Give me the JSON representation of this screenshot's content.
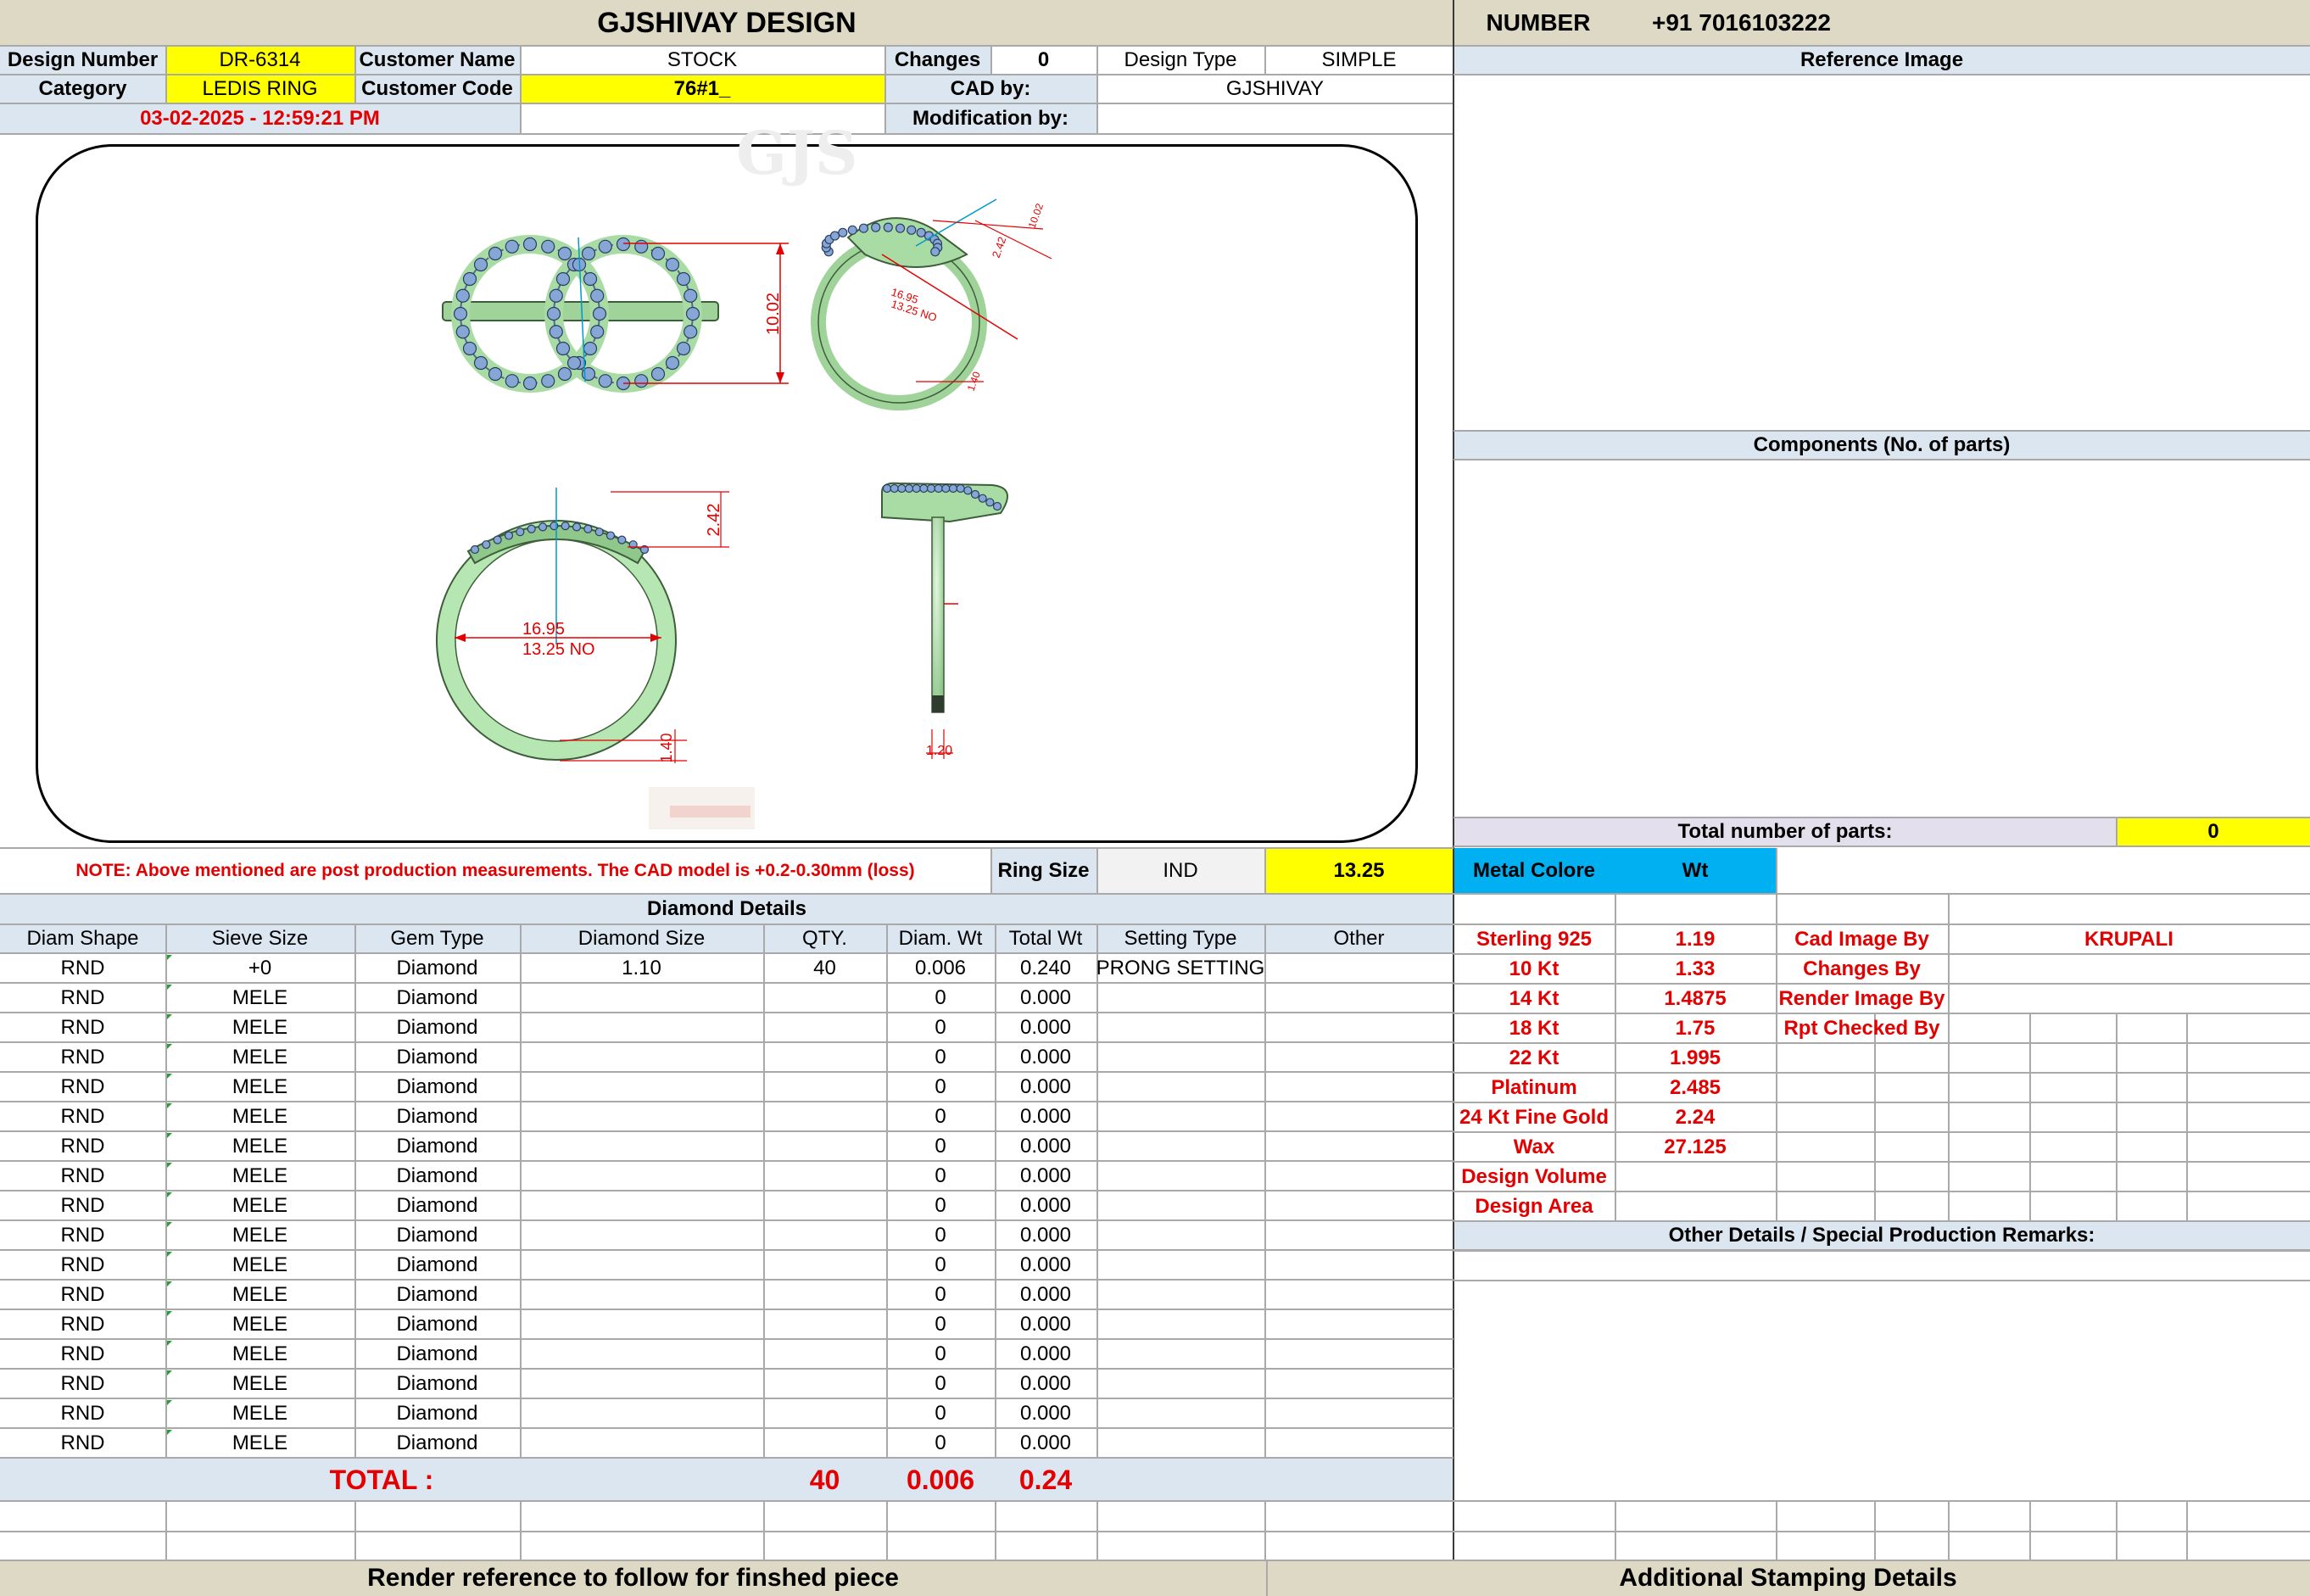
{
  "header": {
    "title": "GJSHIVAY DESIGN",
    "number_label": "NUMBER",
    "number_value": "+91 7016103222"
  },
  "info": {
    "design_number_label": "Design Number",
    "design_number": "DR-6314",
    "customer_name_label": "Customer Name",
    "customer_name": "STOCK",
    "changes_label": "Changes",
    "changes": "0",
    "design_type_label": "Design Type",
    "design_type": "SIMPLE",
    "category_label": "Category",
    "category": "LEDIS RING",
    "customer_code_label": "Customer Code",
    "customer_code": "76#1_",
    "cad_by_label": "CAD by:",
    "cad_by": "GJSHIVAY",
    "datetime": "03-02-2025 - 12:59:21 PM",
    "modification_label": "Modification by:"
  },
  "drawing": {
    "dim_height": "10.02",
    "dim_top": "2.42",
    "dim_diameter": "16.95",
    "dim_ring_no": "13.25 NO",
    "dim_bottom": "1.40",
    "dim_shank": "1.20",
    "dim_iso_a": "16.95",
    "dim_iso_b": "13.25 NO",
    "dim_iso_c": "2.42",
    "dim_iso_d": "10.02",
    "dim_iso_e": "1.40"
  },
  "note": "NOTE: Above mentioned are post production measurements. The CAD model is +0.2-0.30mm (loss)",
  "ring_size": {
    "label": "Ring Size",
    "system": "IND",
    "value": "13.25"
  },
  "diamond": {
    "title": "Diamond Details",
    "headers": [
      "Diam Shape",
      "Sieve Size",
      "Gem Type",
      "Diamond Size",
      "QTY.",
      "Diam. Wt",
      "Total Wt",
      "Setting Type",
      "Other"
    ],
    "rows": [
      [
        "RND",
        "+0",
        "Diamond",
        "1.10",
        "40",
        "0.006",
        "0.240",
        "PRONG SETTING",
        ""
      ],
      [
        "RND",
        "MELE",
        "Diamond",
        "",
        "",
        "0",
        "0.000",
        "",
        ""
      ],
      [
        "RND",
        "MELE",
        "Diamond",
        "",
        "",
        "0",
        "0.000",
        "",
        ""
      ],
      [
        "RND",
        "MELE",
        "Diamond",
        "",
        "",
        "0",
        "0.000",
        "",
        ""
      ],
      [
        "RND",
        "MELE",
        "Diamond",
        "",
        "",
        "0",
        "0.000",
        "",
        ""
      ],
      [
        "RND",
        "MELE",
        "Diamond",
        "",
        "",
        "0",
        "0.000",
        "",
        ""
      ],
      [
        "RND",
        "MELE",
        "Diamond",
        "",
        "",
        "0",
        "0.000",
        "",
        ""
      ],
      [
        "RND",
        "MELE",
        "Diamond",
        "",
        "",
        "0",
        "0.000",
        "",
        ""
      ],
      [
        "RND",
        "MELE",
        "Diamond",
        "",
        "",
        "0",
        "0.000",
        "",
        ""
      ],
      [
        "RND",
        "MELE",
        "Diamond",
        "",
        "",
        "0",
        "0.000",
        "",
        ""
      ],
      [
        "RND",
        "MELE",
        "Diamond",
        "",
        "",
        "0",
        "0.000",
        "",
        ""
      ],
      [
        "RND",
        "MELE",
        "Diamond",
        "",
        "",
        "0",
        "0.000",
        "",
        ""
      ],
      [
        "RND",
        "MELE",
        "Diamond",
        "",
        "",
        "0",
        "0.000",
        "",
        ""
      ],
      [
        "RND",
        "MELE",
        "Diamond",
        "",
        "",
        "0",
        "0.000",
        "",
        ""
      ],
      [
        "RND",
        "MELE",
        "Diamond",
        "",
        "",
        "0",
        "0.000",
        "",
        ""
      ],
      [
        "RND",
        "MELE",
        "Diamond",
        "",
        "",
        "0",
        "0.000",
        "",
        ""
      ],
      [
        "RND",
        "MELE",
        "Diamond",
        "",
        "",
        "0",
        "0.000",
        "",
        ""
      ]
    ],
    "total_label": "TOTAL :",
    "total_qty": "40",
    "total_diam_wt": "0.006",
    "total_wt": "0.24"
  },
  "reference_image_label": "Reference Image",
  "components_label": "Components (No. of parts)",
  "total_parts_label": "Total number of parts:",
  "total_parts": "0",
  "metal": {
    "header_label": "Metal Colore",
    "header_wt": "Wt",
    "rows": [
      [
        "Sterling 925",
        "1.19"
      ],
      [
        "10 Kt",
        "1.33"
      ],
      [
        "14 Kt",
        "1.4875"
      ],
      [
        "18 Kt",
        "1.75"
      ],
      [
        "22 Kt",
        "1.995"
      ],
      [
        "Platinum",
        "2.485"
      ],
      [
        "24 Kt Fine Gold",
        "2.24"
      ],
      [
        "Wax",
        "27.125"
      ],
      [
        "Design Volume",
        ""
      ],
      [
        "Design Area",
        ""
      ]
    ]
  },
  "roles": {
    "rows": [
      [
        "Cad Image By",
        "KRUPALI"
      ],
      [
        "Changes By",
        ""
      ],
      [
        "Render Image By",
        ""
      ],
      [
        "Rpt Checked By",
        ""
      ]
    ]
  },
  "remarks_label": "Other Details / Special Production Remarks:",
  "footer": {
    "left": "Render reference to follow for finshed piece",
    "right": "Additional Stamping Details"
  },
  "colors": {
    "label_blue": "#dce6f1",
    "highlight_yellow": "#ffff00",
    "header_tan": "#ddd9c4",
    "metal_blue": "#00b0f0",
    "red_text": "#e30000",
    "ring_green": "#b9e8b4",
    "stone_blue": "#7f9fd0"
  }
}
